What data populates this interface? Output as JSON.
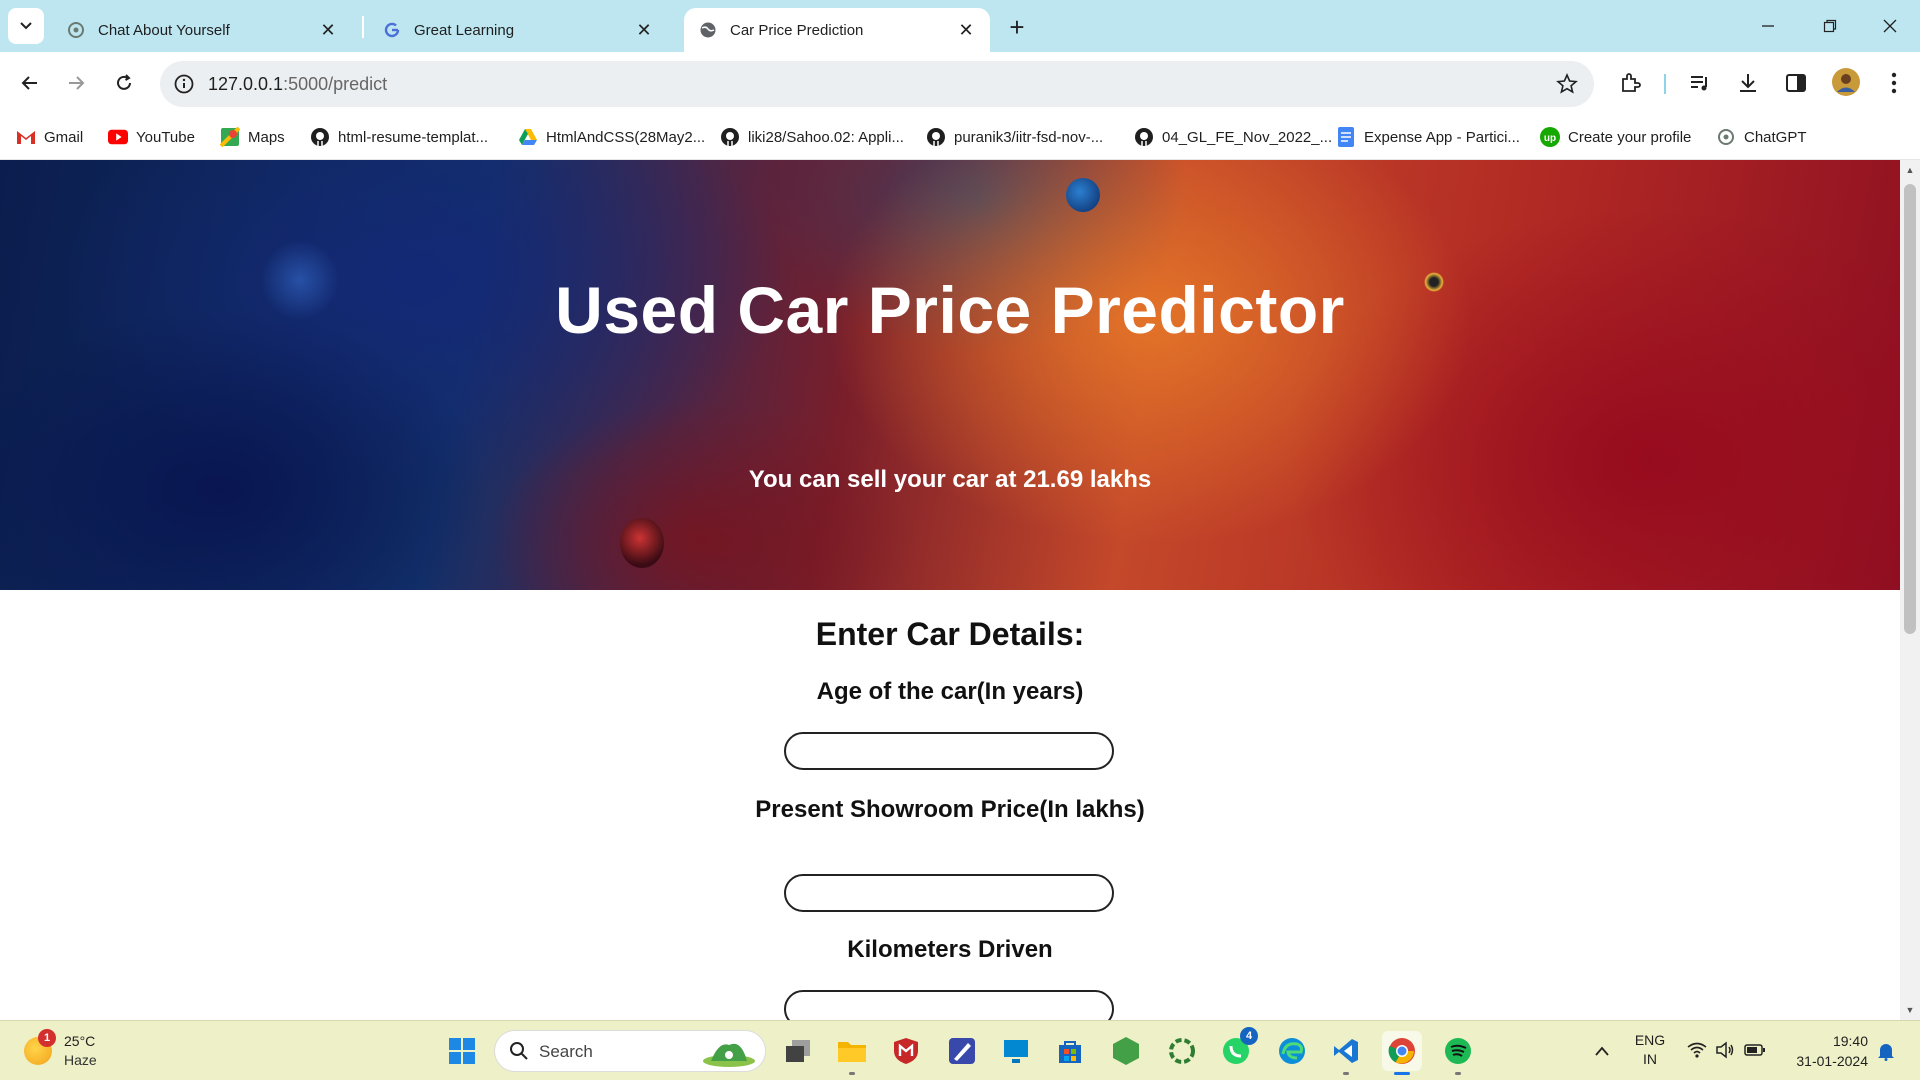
{
  "browser": {
    "tabs": [
      {
        "title": "Chat About Yourself",
        "icon": "openai-icon",
        "active": false
      },
      {
        "title": "Great Learning",
        "icon": "google-icon",
        "active": false
      },
      {
        "title": "Car Price Prediction",
        "icon": "globe-icon",
        "active": true
      }
    ],
    "address": {
      "host": "127.0.0.1",
      "path": ":5000/predict"
    },
    "bookmarks": [
      {
        "label": "Gmail",
        "icon": "gmail-icon"
      },
      {
        "label": "YouTube",
        "icon": "youtube-icon"
      },
      {
        "label": "Maps",
        "icon": "maps-icon"
      },
      {
        "label": "html-resume-templat...",
        "icon": "github-icon"
      },
      {
        "label": "HtmlAndCSS(28May2...",
        "icon": "google-drive-icon"
      },
      {
        "label": "liki28/Sahoo.02: Appli...",
        "icon": "github-icon"
      },
      {
        "label": "puranik3/iitr-fsd-nov-...",
        "icon": "github-icon"
      },
      {
        "label": "04_GL_FE_Nov_2022_...",
        "icon": "github-icon"
      },
      {
        "label": "Expense App - Partici...",
        "icon": "google-docs-icon"
      },
      {
        "label": "Create your profile",
        "icon": "upwork-icon"
      },
      {
        "label": "ChatGPT",
        "icon": "openai-icon"
      }
    ]
  },
  "page": {
    "title": "Used Car Price Predictor",
    "result": "You can sell your car at 21.69 lakhs",
    "form_heading": "Enter Car Details:",
    "fields": [
      {
        "label": "Age of the car(In years)",
        "value": ""
      },
      {
        "label": "Present Showroom Price(In lakhs)",
        "value": ""
      },
      {
        "label": "Kilometers Driven",
        "value": ""
      }
    ]
  },
  "taskbar": {
    "weather": {
      "temp": "25°C",
      "condition": "Haze",
      "badge": "1"
    },
    "search_placeholder": "Search",
    "whatsapp_badge": "4",
    "language": {
      "line1": "ENG",
      "line2": "IN"
    },
    "clock": {
      "time": "19:40",
      "date": "31-01-2024"
    }
  },
  "colors": {
    "tabstrip_bg": "#bde6f1",
    "taskbar_bg": "#eef0c8",
    "hero_text": "#ffffff"
  }
}
